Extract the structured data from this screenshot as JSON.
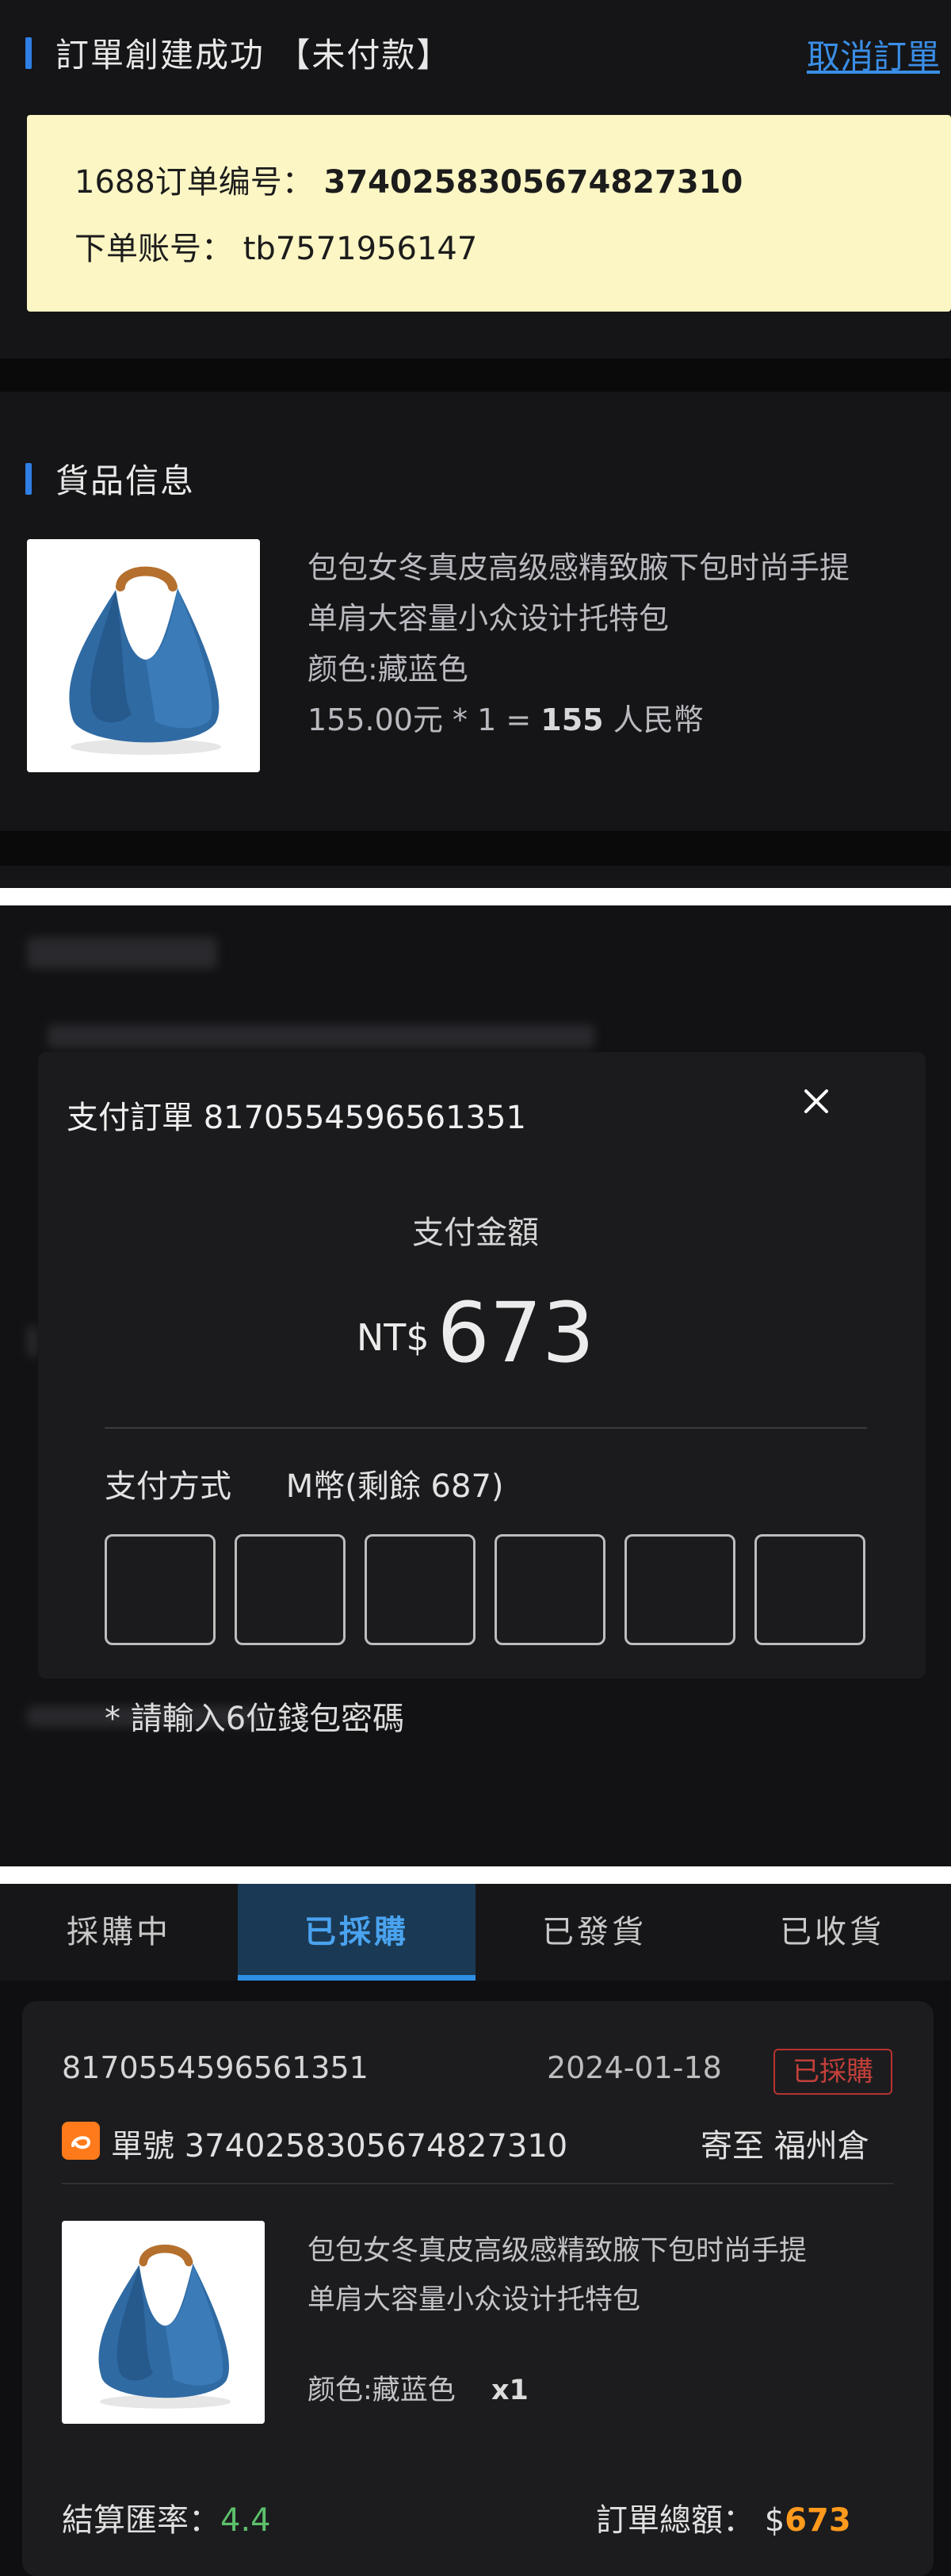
{
  "order_created": {
    "header_title": "訂單創建成功 【未付款】",
    "cancel_label": "取消訂單",
    "order_no_label": "1688订单编号：",
    "order_no": "3740258305674827310",
    "account_label": "下单账号：",
    "account": "tb7571956147"
  },
  "goods": {
    "section_title": "貨品信息",
    "name_line1": "包包女冬真皮高级感精致腋下包时尚手提",
    "name_line2": "单肩大容量小众设计托特包",
    "color": "颜色:藏蓝色",
    "price_calc": "155.00元 * 1 = ",
    "price_total": "155",
    "currency": " 人民幣"
  },
  "payment_modal": {
    "title": "支付訂單 8170554596561351",
    "amount_label": "支付金額",
    "currency": "NT$",
    "amount": "673",
    "method_label": "支付方式",
    "method_value": "M幣(剩餘 687)",
    "pin_hint": "* 請輸入6位錢包密碼",
    "pin_digits": 6
  },
  "orders_list": {
    "tabs": [
      {
        "label": "採購中",
        "active": false
      },
      {
        "label": "已採購",
        "active": true
      },
      {
        "label": "已發貨",
        "active": false
      },
      {
        "label": "已收貨",
        "active": false
      }
    ],
    "card": {
      "order_id": "8170554596561351",
      "date": "2024-01-18",
      "status": "已採購",
      "ali_order_label": "單號 3740258305674827310",
      "ship_to": "寄至 福州倉",
      "name_line1": "包包女冬真皮高级感精致腋下包时尚手提",
      "name_line2": "单肩大容量小众设计托特包",
      "color": "颜色:藏蓝色",
      "qty": "x1",
      "rate_label": "結算匯率：",
      "rate": "4.4",
      "total_label": "訂單總額： $",
      "total": "673"
    }
  },
  "colors": {
    "accent_blue": "#2f7fe6",
    "link_blue": "#3a8ee6",
    "notice_yellow": "#fbf6c4",
    "status_red": "#b8332f",
    "amount_orange": "#ff9a1c",
    "rate_green": "#5cc06b"
  }
}
